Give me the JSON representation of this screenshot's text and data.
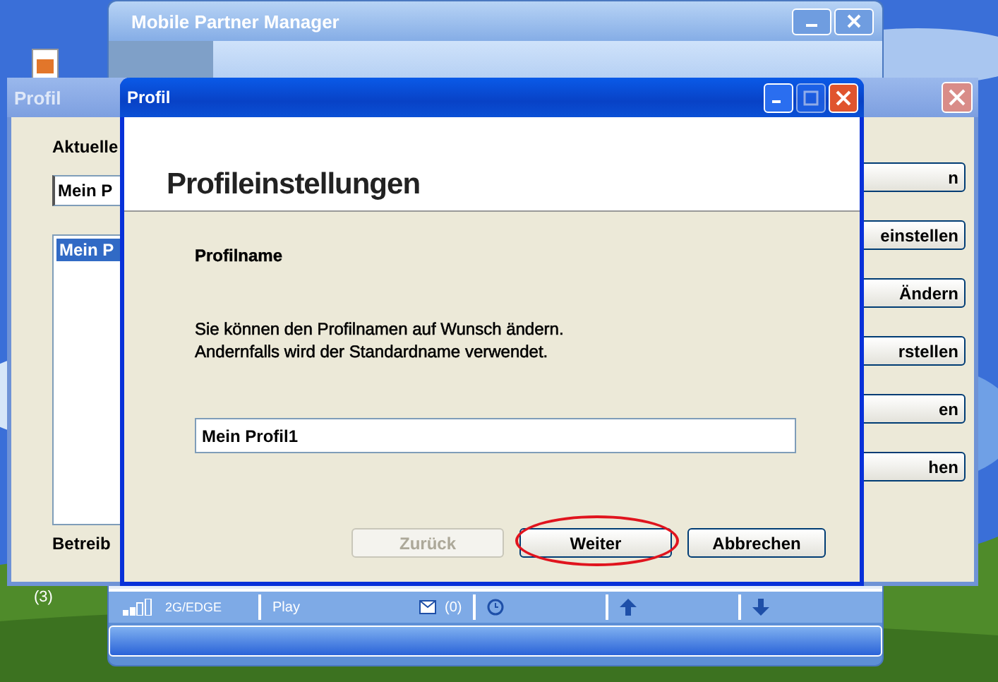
{
  "desktop": {
    "icon_caption": "(3)"
  },
  "manager_window": {
    "title": "Mobile Partner Manager",
    "status_bar": {
      "network": "2G/EDGE",
      "operator": "Play",
      "messages": "(0)"
    }
  },
  "back_window": {
    "title": "Profil",
    "current_label": "Aktuelle",
    "current_value": "Mein P",
    "list_items": [
      {
        "label": "Mein P",
        "selected": true
      }
    ],
    "footer_label": "Betreib",
    "buttons": [
      "n",
      "einstellen",
      "Ändern",
      "rstellen",
      "en",
      "hen"
    ]
  },
  "dialog": {
    "title": "Profil",
    "heading": "Profileinstellungen",
    "field_label": "Profilname",
    "description_lines": [
      "Sie können den Profilnamen auf Wunsch ändern.",
      "Andernfalls wird der Standardname verwendet."
    ],
    "field_value": "Mein Profil1",
    "buttons": [
      {
        "label": "Zurück",
        "disabled": true,
        "highlighted": false
      },
      {
        "label": "Weiter",
        "disabled": false,
        "highlighted": true
      },
      {
        "label": "Abbrechen",
        "disabled": false,
        "highlighted": false
      }
    ]
  }
}
